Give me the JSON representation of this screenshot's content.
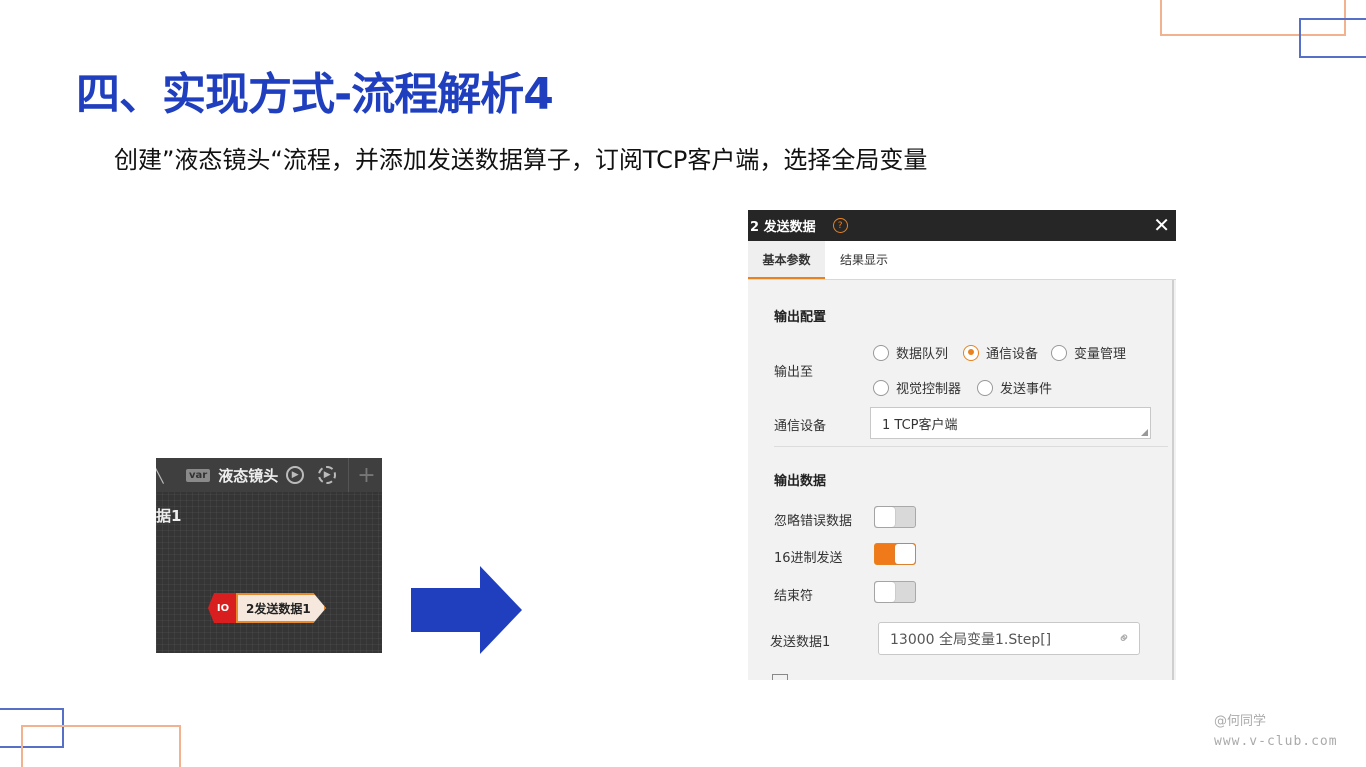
{
  "slide": {
    "title": "四、实现方式-流程解析4",
    "subtitle": "创建”液态镜头“流程，并添加发送数据算子，订阅TCP客户端，选择全局变量"
  },
  "canvas": {
    "toolbar_var": "var",
    "process_name": "液态镜头",
    "add_label": "+",
    "node_list_label": "据1",
    "node_icon_text": "IO",
    "node_label": "2发送数据1"
  },
  "dialog": {
    "title": "2 发送数据",
    "help": "?",
    "close": "✕",
    "tabs": [
      {
        "label": "基本参数",
        "active": true
      },
      {
        "label": "结果显示",
        "active": false
      }
    ],
    "output_config": {
      "header": "输出配置",
      "output_to_label": "输出至",
      "options": [
        {
          "label": "数据队列",
          "selected": false
        },
        {
          "label": "通信设备",
          "selected": true
        },
        {
          "label": "变量管理",
          "selected": false
        },
        {
          "label": "视觉控制器",
          "selected": false
        },
        {
          "label": "发送事件",
          "selected": false
        }
      ],
      "device_label": "通信设备",
      "device_value": "1 TCP客户端"
    },
    "output_data": {
      "header": "输出数据",
      "ignore_error_label": "忽略错误数据",
      "ignore_error_on": false,
      "hex_send_label": "16进制发送",
      "hex_send_on": true,
      "terminator_label": "结束符",
      "terminator_on": false,
      "send_data_label": "发送数据1",
      "send_data_value": "13000 全局变量1.Step[]"
    }
  },
  "watermark": {
    "author": "@何同学",
    "site": "www.v-club.com"
  },
  "colors": {
    "title_blue": "#1f3fbf",
    "accent_orange": "#e8821f",
    "arrow_blue": "#1f3fbf",
    "deco_orange": "#f3b28f",
    "deco_blue": "#5670c8"
  }
}
